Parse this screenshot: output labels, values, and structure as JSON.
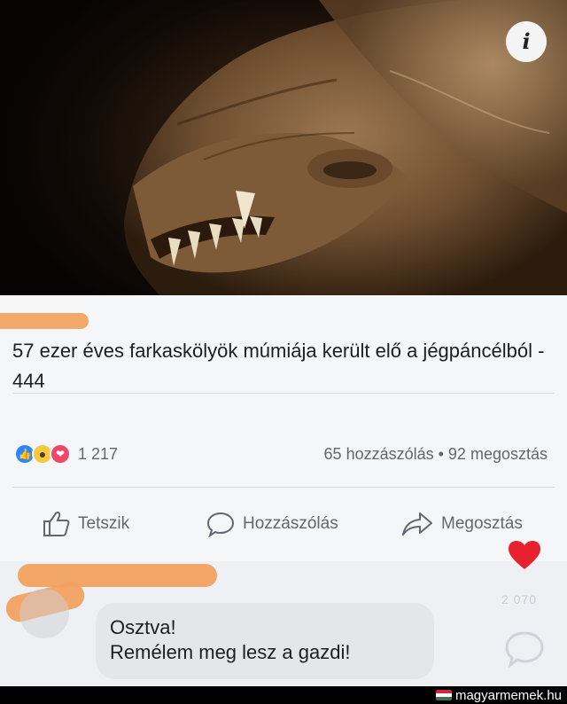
{
  "photo": {
    "info_button": "i"
  },
  "post": {
    "headline": "57 ezer éves farkaskölyök múmiája került elő a jégpáncélból - 444",
    "reactions": {
      "icons": [
        "like-icon",
        "wow-icon",
        "love-icon"
      ],
      "count": "1 217"
    },
    "stats": "65 hozzászólás • 92 megosztás",
    "actions": {
      "like_label": "Tetszik",
      "comment_label": "Hozzászólás",
      "share_label": "Megosztás"
    }
  },
  "comment": {
    "line1": "Osztva!",
    "line2": "Remélem meg lesz a gazdi!",
    "faint_count": "2 070"
  },
  "watermark": {
    "brand": "magyarmemek.hu"
  },
  "colors": {
    "redaction": "#f2a15d",
    "heart": "#e8212e",
    "like": "#2d86ff"
  }
}
